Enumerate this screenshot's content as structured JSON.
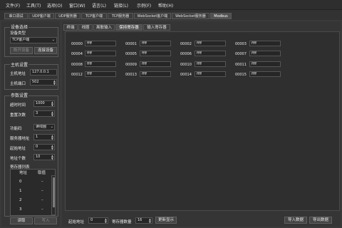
{
  "menu": [
    "文件(F)",
    "工具(T)",
    "选项(O)",
    "窗口(W)",
    "语言(L)",
    "链接(L)",
    "示例(F)",
    "帮助(H)"
  ],
  "top_tabs": [
    "串口调试",
    "UDP客户端",
    "UDP服务器",
    "TCP客户端",
    "TCP服务器",
    "WebSocket客户端",
    "WebSocket服务器",
    "Modbus"
  ],
  "active_top_tab": 7,
  "left": {
    "device_group": "设备选择",
    "device_type_label": "设备类型",
    "device_type_value": "TCP客户端",
    "open_device": "断开设备",
    "connect_device": "连接设备",
    "host_group": "主机设置",
    "host_addr_label": "主机地址",
    "host_addr_value": "127.0.0.1",
    "host_port_label": "主机端口",
    "host_port_value": "502",
    "param_group": "参数设置",
    "timeout_label": "超时时间",
    "timeout_value": "1000",
    "retry_label": "重置次数",
    "retry_value": "3",
    "func_label": "功能码",
    "func_value": "读线圈",
    "server_addr_label": "服务器地址",
    "server_addr_value": "1",
    "start_addr_label": "起始地址",
    "start_addr_value": "0",
    "addr_count_label": "地址个数",
    "addr_count_value": "10",
    "reg_list_label": "寄存器列表",
    "col_addr": "地址",
    "col_value": "取值",
    "rows": [
      {
        "addr": "0",
        "value": "–"
      },
      {
        "addr": "1",
        "value": "–"
      },
      {
        "addr": "2",
        "value": "–"
      },
      {
        "addr": "3",
        "value": "–"
      }
    ],
    "read_button": "读取",
    "write_button": "写入"
  },
  "sub_tabs": [
    "终端",
    "线圈",
    "离散输入",
    "保持寄存器",
    "输入寄存器"
  ],
  "active_sub_tab": 3,
  "registers": [
    [
      "00000",
      "00001",
      "00002",
      "00003"
    ],
    [
      "00004",
      "00005",
      "00006",
      "00007"
    ],
    [
      "00008",
      "00009",
      "00010",
      "00011"
    ],
    [
      "00012",
      "00013",
      "00014",
      "00015"
    ]
  ],
  "register_value": "ffff",
  "bottom": {
    "start_addr_label": "起始地址",
    "start_addr_value": "0",
    "reg_count_label": "寄存器数量",
    "reg_count_value": "16",
    "update_button": "更新显示",
    "import_button": "导入数据",
    "export_button": "导出数据"
  }
}
